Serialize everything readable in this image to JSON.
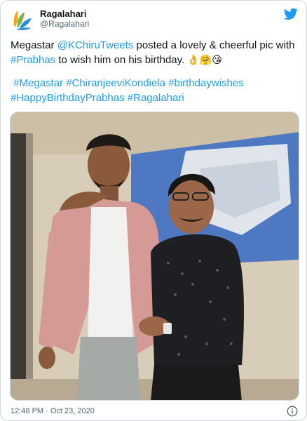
{
  "account": {
    "display_name": "Ragalahari",
    "handle": "@Ragalahari",
    "avatar_icon": "ragalahari-logo",
    "brand_icon": "twitter-bird-icon"
  },
  "tweet": {
    "line1_prefix": "Megastar ",
    "mention": "@KChiruTweets",
    "line1_suffix": " posted a lovely & cheerful pic with",
    "hashtag_prabhas": "#Prabhas",
    "line2_suffix": " to wish him on his birthday. ",
    "emojis": "👌🤗😘",
    "hashtags_line1": [
      "#Megastar",
      "#ChiranjeeviKondiela",
      "#birthdaywishes"
    ],
    "hashtags_line2": [
      "#HappyBirthdayPrabhas",
      "#Ragalahari"
    ]
  },
  "footer": {
    "timestamp": "12:48 PM · Oct 23, 2020",
    "info_icon": "info-icon"
  },
  "colors": {
    "link": "#1d9bf0",
    "brand": "#1d9bf0",
    "text": "#0f1419",
    "muted": "#536471"
  }
}
